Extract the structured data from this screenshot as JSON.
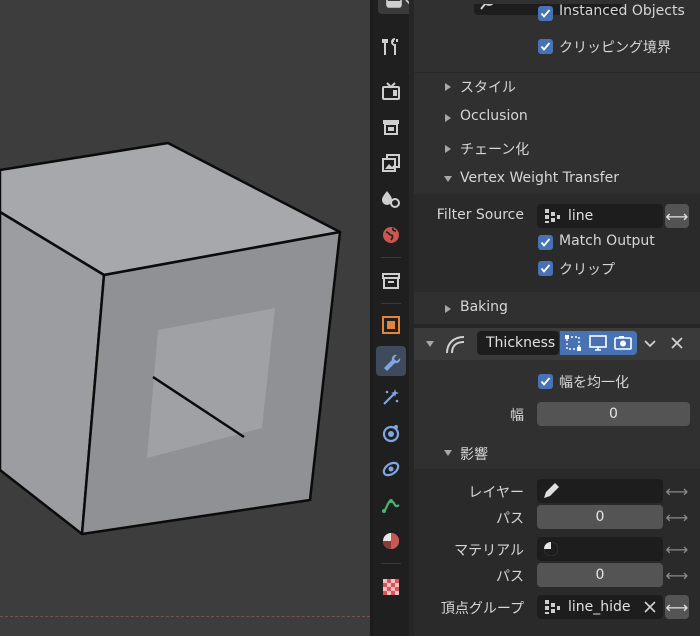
{
  "properties": {
    "partial_top_label": "Instanced Objects",
    "clipping_border_label": "クリッピング境界",
    "sections": {
      "style": "スタイル",
      "occlusion": "Occlusion",
      "chain": "チェーン化",
      "vertex_weight_transfer": "Vertex Weight Transfer",
      "baking": "Baking",
      "influence": "影響"
    },
    "filter_source": {
      "label": "Filter Source",
      "value": "line"
    },
    "match_output_label": "Match Output",
    "clip_label": "クリップ",
    "modifier": {
      "name": "Thickness"
    },
    "uniform_thickness_label": "幅を均一化",
    "width": {
      "label": "幅",
      "value": "0"
    },
    "layer": {
      "label": "レイヤー",
      "value": ""
    },
    "layer_pass": {
      "label": "パス",
      "value": "0"
    },
    "material": {
      "label": "マテリアル",
      "value": ""
    },
    "material_pass": {
      "label": "パス",
      "value": "0"
    },
    "vertex_group": {
      "label": "頂点グループ",
      "value": "line_hide"
    }
  },
  "colors": {
    "accent": "#4772b3",
    "active_tab": "#3f4a5c",
    "viewport_bg": "#3d3d3d",
    "cube_face_front": "#8f9194",
    "cube_face_top": "#a6a8ab",
    "cube_face_left": "#9b9da0"
  },
  "icons": [
    "editor-type-icon",
    "search-icon",
    "tool-icon",
    "render-icon",
    "output-icon",
    "view-layer-icon",
    "scene-icon",
    "world-icon",
    "collection-icon",
    "object-icon",
    "modifier-icon",
    "particles-icon",
    "physics-icon",
    "constraints-icon",
    "data-icon",
    "material-icon",
    "texture-icon"
  ]
}
